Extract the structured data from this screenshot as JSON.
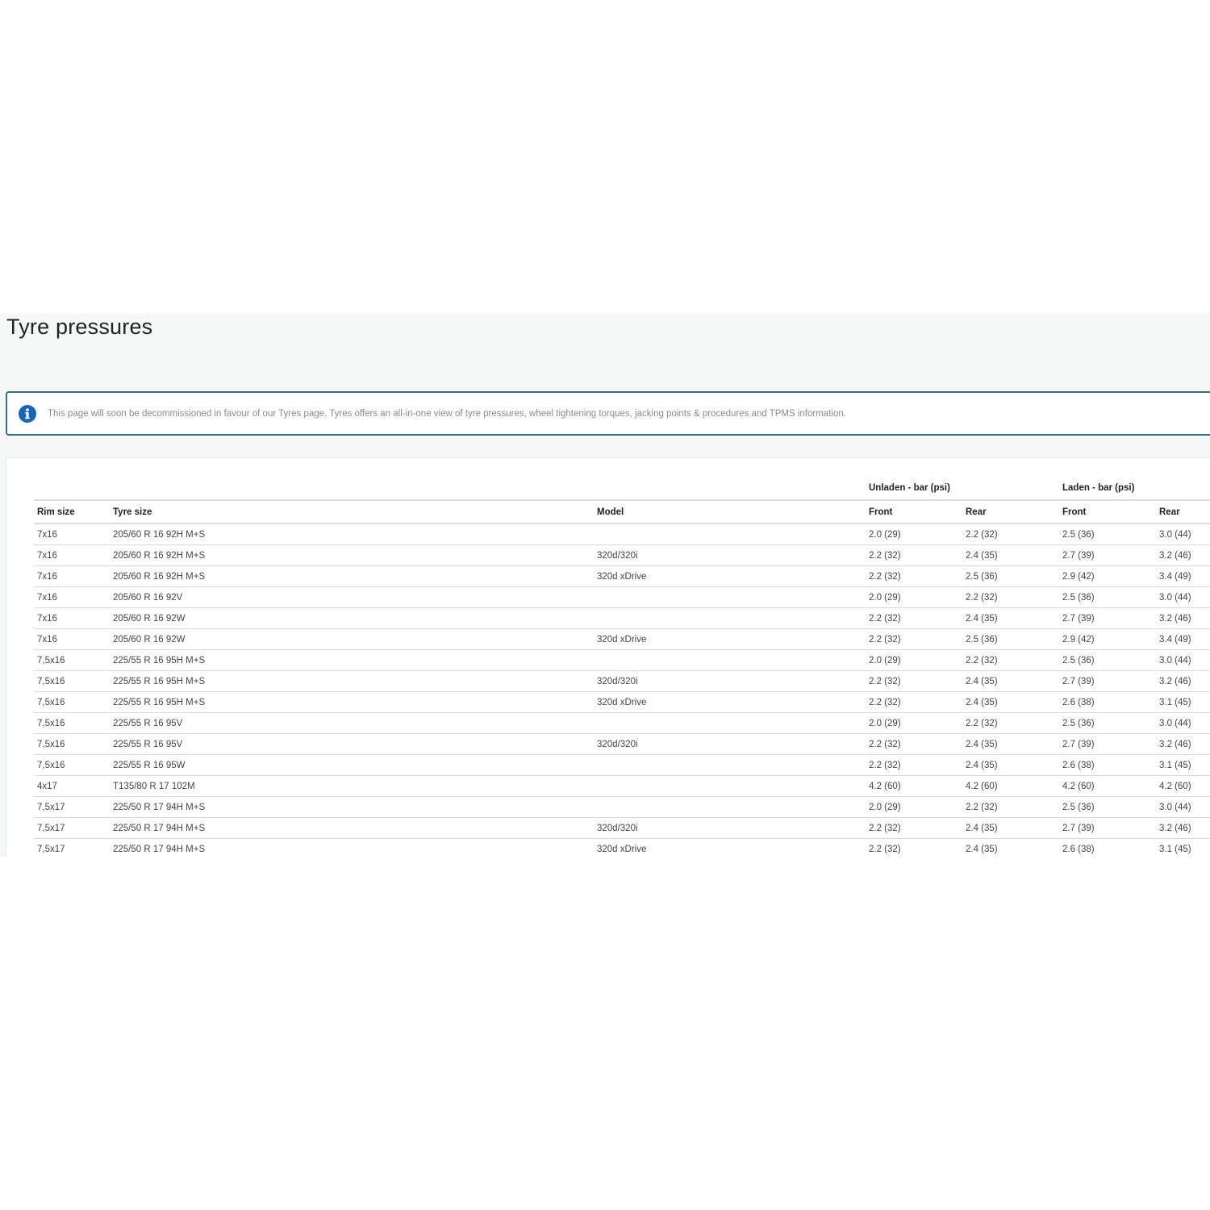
{
  "page": {
    "title": "Tyre pressures",
    "notice": "This page will soon be decommissioned in favour of our Tyres page. Tyres offers an all-in-one view of tyre pressures, wheel tightening torques, jacking points & procedures and TPMS information."
  },
  "table": {
    "groups": {
      "unladen": "Unladen - bar (psi)",
      "laden": "Laden - bar (psi)"
    },
    "headers": {
      "rim": "Rim size",
      "tyre": "Tyre size",
      "model": "Model",
      "unladen_front": "Front",
      "unladen_rear": "Rear",
      "laden_front": "Front",
      "laden_rear": "Rear"
    },
    "rows": [
      [
        "7x16",
        "205/60 R 16 92H M+S",
        "",
        "2.0 (29)",
        "2.2 (32)",
        "2.5 (36)",
        "3.0 (44)"
      ],
      [
        "7x16",
        "205/60 R 16 92H M+S",
        "320d/320i",
        "2.2 (32)",
        "2.4 (35)",
        "2.7 (39)",
        "3.2 (46)"
      ],
      [
        "7x16",
        "205/60 R 16 92H M+S",
        "320d xDrive",
        "2.2 (32)",
        "2.5 (36)",
        "2.9 (42)",
        "3.4 (49)"
      ],
      [
        "7x16",
        "205/60 R 16 92V",
        "",
        "2.0 (29)",
        "2.2 (32)",
        "2.5 (36)",
        "3.0 (44)"
      ],
      [
        "7x16",
        "205/60 R 16 92W",
        "",
        "2.2 (32)",
        "2.4 (35)",
        "2.7 (39)",
        "3.2 (46)"
      ],
      [
        "7x16",
        "205/60 R 16 92W",
        "320d xDrive",
        "2.2 (32)",
        "2.5 (36)",
        "2.9 (42)",
        "3.4 (49)"
      ],
      [
        "7,5x16",
        "225/55 R 16 95H M+S",
        "",
        "2.0 (29)",
        "2.2 (32)",
        "2.5 (36)",
        "3.0 (44)"
      ],
      [
        "7,5x16",
        "225/55 R 16 95H M+S",
        "320d/320i",
        "2.2 (32)",
        "2.4 (35)",
        "2.7 (39)",
        "3.2 (46)"
      ],
      [
        "7,5x16",
        "225/55 R 16 95H M+S",
        "320d xDrive",
        "2.2 (32)",
        "2.4 (35)",
        "2.6 (38)",
        "3.1 (45)"
      ],
      [
        "7,5x16",
        "225/55 R 16 95V",
        "",
        "2.0 (29)",
        "2.2 (32)",
        "2.5 (36)",
        "3.0 (44)"
      ],
      [
        "7,5x16",
        "225/55 R 16 95V",
        "320d/320i",
        "2.2 (32)",
        "2.4 (35)",
        "2.7 (39)",
        "3.2 (46)"
      ],
      [
        "7,5x16",
        "225/55 R 16 95W",
        "",
        "2.2 (32)",
        "2.4 (35)",
        "2.6 (38)",
        "3.1 (45)"
      ],
      [
        "4x17",
        "T135/80 R 17 102M",
        "",
        "4.2 (60)",
        "4.2 (60)",
        "4.2 (60)",
        "4.2 (60)"
      ],
      [
        "7,5x17",
        "225/50 R 17 94H M+S",
        "",
        "2.0 (29)",
        "2.2 (32)",
        "2.5 (36)",
        "3.0 (44)"
      ],
      [
        "7,5x17",
        "225/50 R 17 94H M+S",
        "320d/320i",
        "2.2 (32)",
        "2.4 (35)",
        "2.7 (39)",
        "3.2 (46)"
      ],
      [
        "7,5x17",
        "225/50 R 17 94H M+S",
        "320d xDrive",
        "2.2 (32)",
        "2.4 (35)",
        "2.6 (38)",
        "3.1 (45)"
      ]
    ]
  },
  "colors": {
    "info_icon": "#1565c0",
    "notice_border": "#2f6f8f",
    "page_background": "#f5f8f7"
  }
}
